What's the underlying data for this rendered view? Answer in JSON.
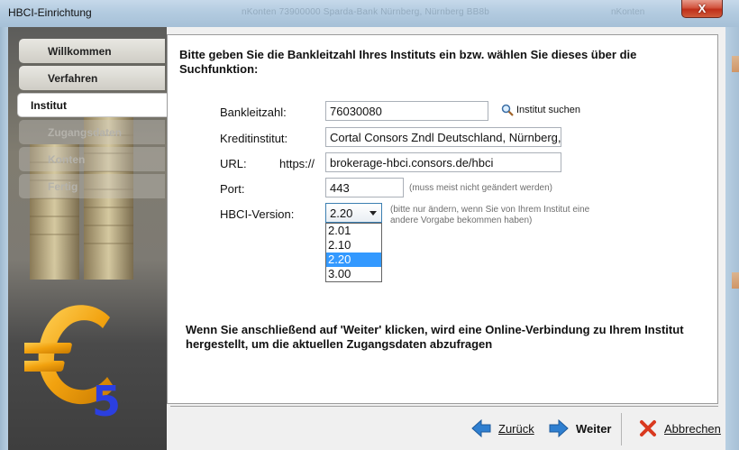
{
  "window": {
    "title": "HBCI-Einrichtung",
    "background_title": "nKonten    73900000  Sparda-Bank Nürnberg, Nürnberg  BB8b",
    "background_min": "nKonten",
    "close_symbol": "X"
  },
  "sidebar": {
    "items": [
      {
        "label": "Willkommen",
        "state": "done"
      },
      {
        "label": "Verfahren",
        "state": "done"
      },
      {
        "label": "Institut",
        "state": "active"
      },
      {
        "label": "Zugangsdaten",
        "state": "disabled"
      },
      {
        "label": "Konten",
        "state": "disabled"
      },
      {
        "label": "Fertig",
        "state": "disabled"
      }
    ],
    "logo_digit": "5"
  },
  "form": {
    "heading": "Bitte geben Sie die Bankleitzahl Ihres Instituts ein bzw. wählen Sie dieses über die Suchfunktion:",
    "blz_label": "Bankleitzahl:",
    "blz_value": "76030080",
    "search_label": "Institut suchen",
    "institut_label": "Kreditinstitut:",
    "institut_value": "Cortal Consors Zndl Deutschland, Nürnberg,",
    "url_label": "URL:",
    "url_prefix": "https://",
    "url_value": "brokerage-hbci.consors.de/hbci",
    "port_label": "Port:",
    "port_value": "443",
    "port_hint": "(muss meist nicht geändert werden)",
    "version_label": "HBCI-Version:",
    "version_value": "2.20",
    "version_hint": "(bitte nur ändern, wenn Sie von Ihrem Institut eine andere Vorgabe bekommen haben)",
    "version_options": [
      "2.01",
      "2.10",
      "2.20",
      "3.00"
    ],
    "version_selected": "2.20",
    "note": "Wenn Sie anschließend auf 'Weiter' klicken, wird eine Online-Verbindung zu Ihrem Institut hergestellt, um die aktuellen Zugangsdaten abzufragen"
  },
  "buttons": {
    "back_label": "Zurück",
    "next_label": "Weiter",
    "cancel_label": "Abbrechen"
  },
  "colors": {
    "accent": "#3399ff",
    "euro": "#f2a20f",
    "digit": "#2b3fe0",
    "arrow": "#2f7fd0",
    "cancel": "#d9391f"
  }
}
